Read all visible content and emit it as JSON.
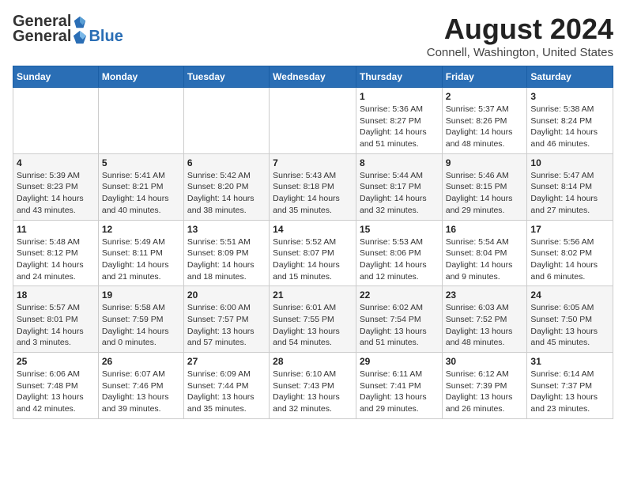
{
  "header": {
    "logo_general": "General",
    "logo_blue": "Blue",
    "title": "August 2024",
    "subtitle": "Connell, Washington, United States"
  },
  "days_of_week": [
    "Sunday",
    "Monday",
    "Tuesday",
    "Wednesday",
    "Thursday",
    "Friday",
    "Saturday"
  ],
  "weeks": [
    [
      {
        "day": "",
        "info": ""
      },
      {
        "day": "",
        "info": ""
      },
      {
        "day": "",
        "info": ""
      },
      {
        "day": "",
        "info": ""
      },
      {
        "day": "1",
        "info": "Sunrise: 5:36 AM\nSunset: 8:27 PM\nDaylight: 14 hours and 51 minutes."
      },
      {
        "day": "2",
        "info": "Sunrise: 5:37 AM\nSunset: 8:26 PM\nDaylight: 14 hours and 48 minutes."
      },
      {
        "day": "3",
        "info": "Sunrise: 5:38 AM\nSunset: 8:24 PM\nDaylight: 14 hours and 46 minutes."
      }
    ],
    [
      {
        "day": "4",
        "info": "Sunrise: 5:39 AM\nSunset: 8:23 PM\nDaylight: 14 hours and 43 minutes."
      },
      {
        "day": "5",
        "info": "Sunrise: 5:41 AM\nSunset: 8:21 PM\nDaylight: 14 hours and 40 minutes."
      },
      {
        "day": "6",
        "info": "Sunrise: 5:42 AM\nSunset: 8:20 PM\nDaylight: 14 hours and 38 minutes."
      },
      {
        "day": "7",
        "info": "Sunrise: 5:43 AM\nSunset: 8:18 PM\nDaylight: 14 hours and 35 minutes."
      },
      {
        "day": "8",
        "info": "Sunrise: 5:44 AM\nSunset: 8:17 PM\nDaylight: 14 hours and 32 minutes."
      },
      {
        "day": "9",
        "info": "Sunrise: 5:46 AM\nSunset: 8:15 PM\nDaylight: 14 hours and 29 minutes."
      },
      {
        "day": "10",
        "info": "Sunrise: 5:47 AM\nSunset: 8:14 PM\nDaylight: 14 hours and 27 minutes."
      }
    ],
    [
      {
        "day": "11",
        "info": "Sunrise: 5:48 AM\nSunset: 8:12 PM\nDaylight: 14 hours and 24 minutes."
      },
      {
        "day": "12",
        "info": "Sunrise: 5:49 AM\nSunset: 8:11 PM\nDaylight: 14 hours and 21 minutes."
      },
      {
        "day": "13",
        "info": "Sunrise: 5:51 AM\nSunset: 8:09 PM\nDaylight: 14 hours and 18 minutes."
      },
      {
        "day": "14",
        "info": "Sunrise: 5:52 AM\nSunset: 8:07 PM\nDaylight: 14 hours and 15 minutes."
      },
      {
        "day": "15",
        "info": "Sunrise: 5:53 AM\nSunset: 8:06 PM\nDaylight: 14 hours and 12 minutes."
      },
      {
        "day": "16",
        "info": "Sunrise: 5:54 AM\nSunset: 8:04 PM\nDaylight: 14 hours and 9 minutes."
      },
      {
        "day": "17",
        "info": "Sunrise: 5:56 AM\nSunset: 8:02 PM\nDaylight: 14 hours and 6 minutes."
      }
    ],
    [
      {
        "day": "18",
        "info": "Sunrise: 5:57 AM\nSunset: 8:01 PM\nDaylight: 14 hours and 3 minutes."
      },
      {
        "day": "19",
        "info": "Sunrise: 5:58 AM\nSunset: 7:59 PM\nDaylight: 14 hours and 0 minutes."
      },
      {
        "day": "20",
        "info": "Sunrise: 6:00 AM\nSunset: 7:57 PM\nDaylight: 13 hours and 57 minutes."
      },
      {
        "day": "21",
        "info": "Sunrise: 6:01 AM\nSunset: 7:55 PM\nDaylight: 13 hours and 54 minutes."
      },
      {
        "day": "22",
        "info": "Sunrise: 6:02 AM\nSunset: 7:54 PM\nDaylight: 13 hours and 51 minutes."
      },
      {
        "day": "23",
        "info": "Sunrise: 6:03 AM\nSunset: 7:52 PM\nDaylight: 13 hours and 48 minutes."
      },
      {
        "day": "24",
        "info": "Sunrise: 6:05 AM\nSunset: 7:50 PM\nDaylight: 13 hours and 45 minutes."
      }
    ],
    [
      {
        "day": "25",
        "info": "Sunrise: 6:06 AM\nSunset: 7:48 PM\nDaylight: 13 hours and 42 minutes."
      },
      {
        "day": "26",
        "info": "Sunrise: 6:07 AM\nSunset: 7:46 PM\nDaylight: 13 hours and 39 minutes."
      },
      {
        "day": "27",
        "info": "Sunrise: 6:09 AM\nSunset: 7:44 PM\nDaylight: 13 hours and 35 minutes."
      },
      {
        "day": "28",
        "info": "Sunrise: 6:10 AM\nSunset: 7:43 PM\nDaylight: 13 hours and 32 minutes."
      },
      {
        "day": "29",
        "info": "Sunrise: 6:11 AM\nSunset: 7:41 PM\nDaylight: 13 hours and 29 minutes."
      },
      {
        "day": "30",
        "info": "Sunrise: 6:12 AM\nSunset: 7:39 PM\nDaylight: 13 hours and 26 minutes."
      },
      {
        "day": "31",
        "info": "Sunrise: 6:14 AM\nSunset: 7:37 PM\nDaylight: 13 hours and 23 minutes."
      }
    ]
  ]
}
